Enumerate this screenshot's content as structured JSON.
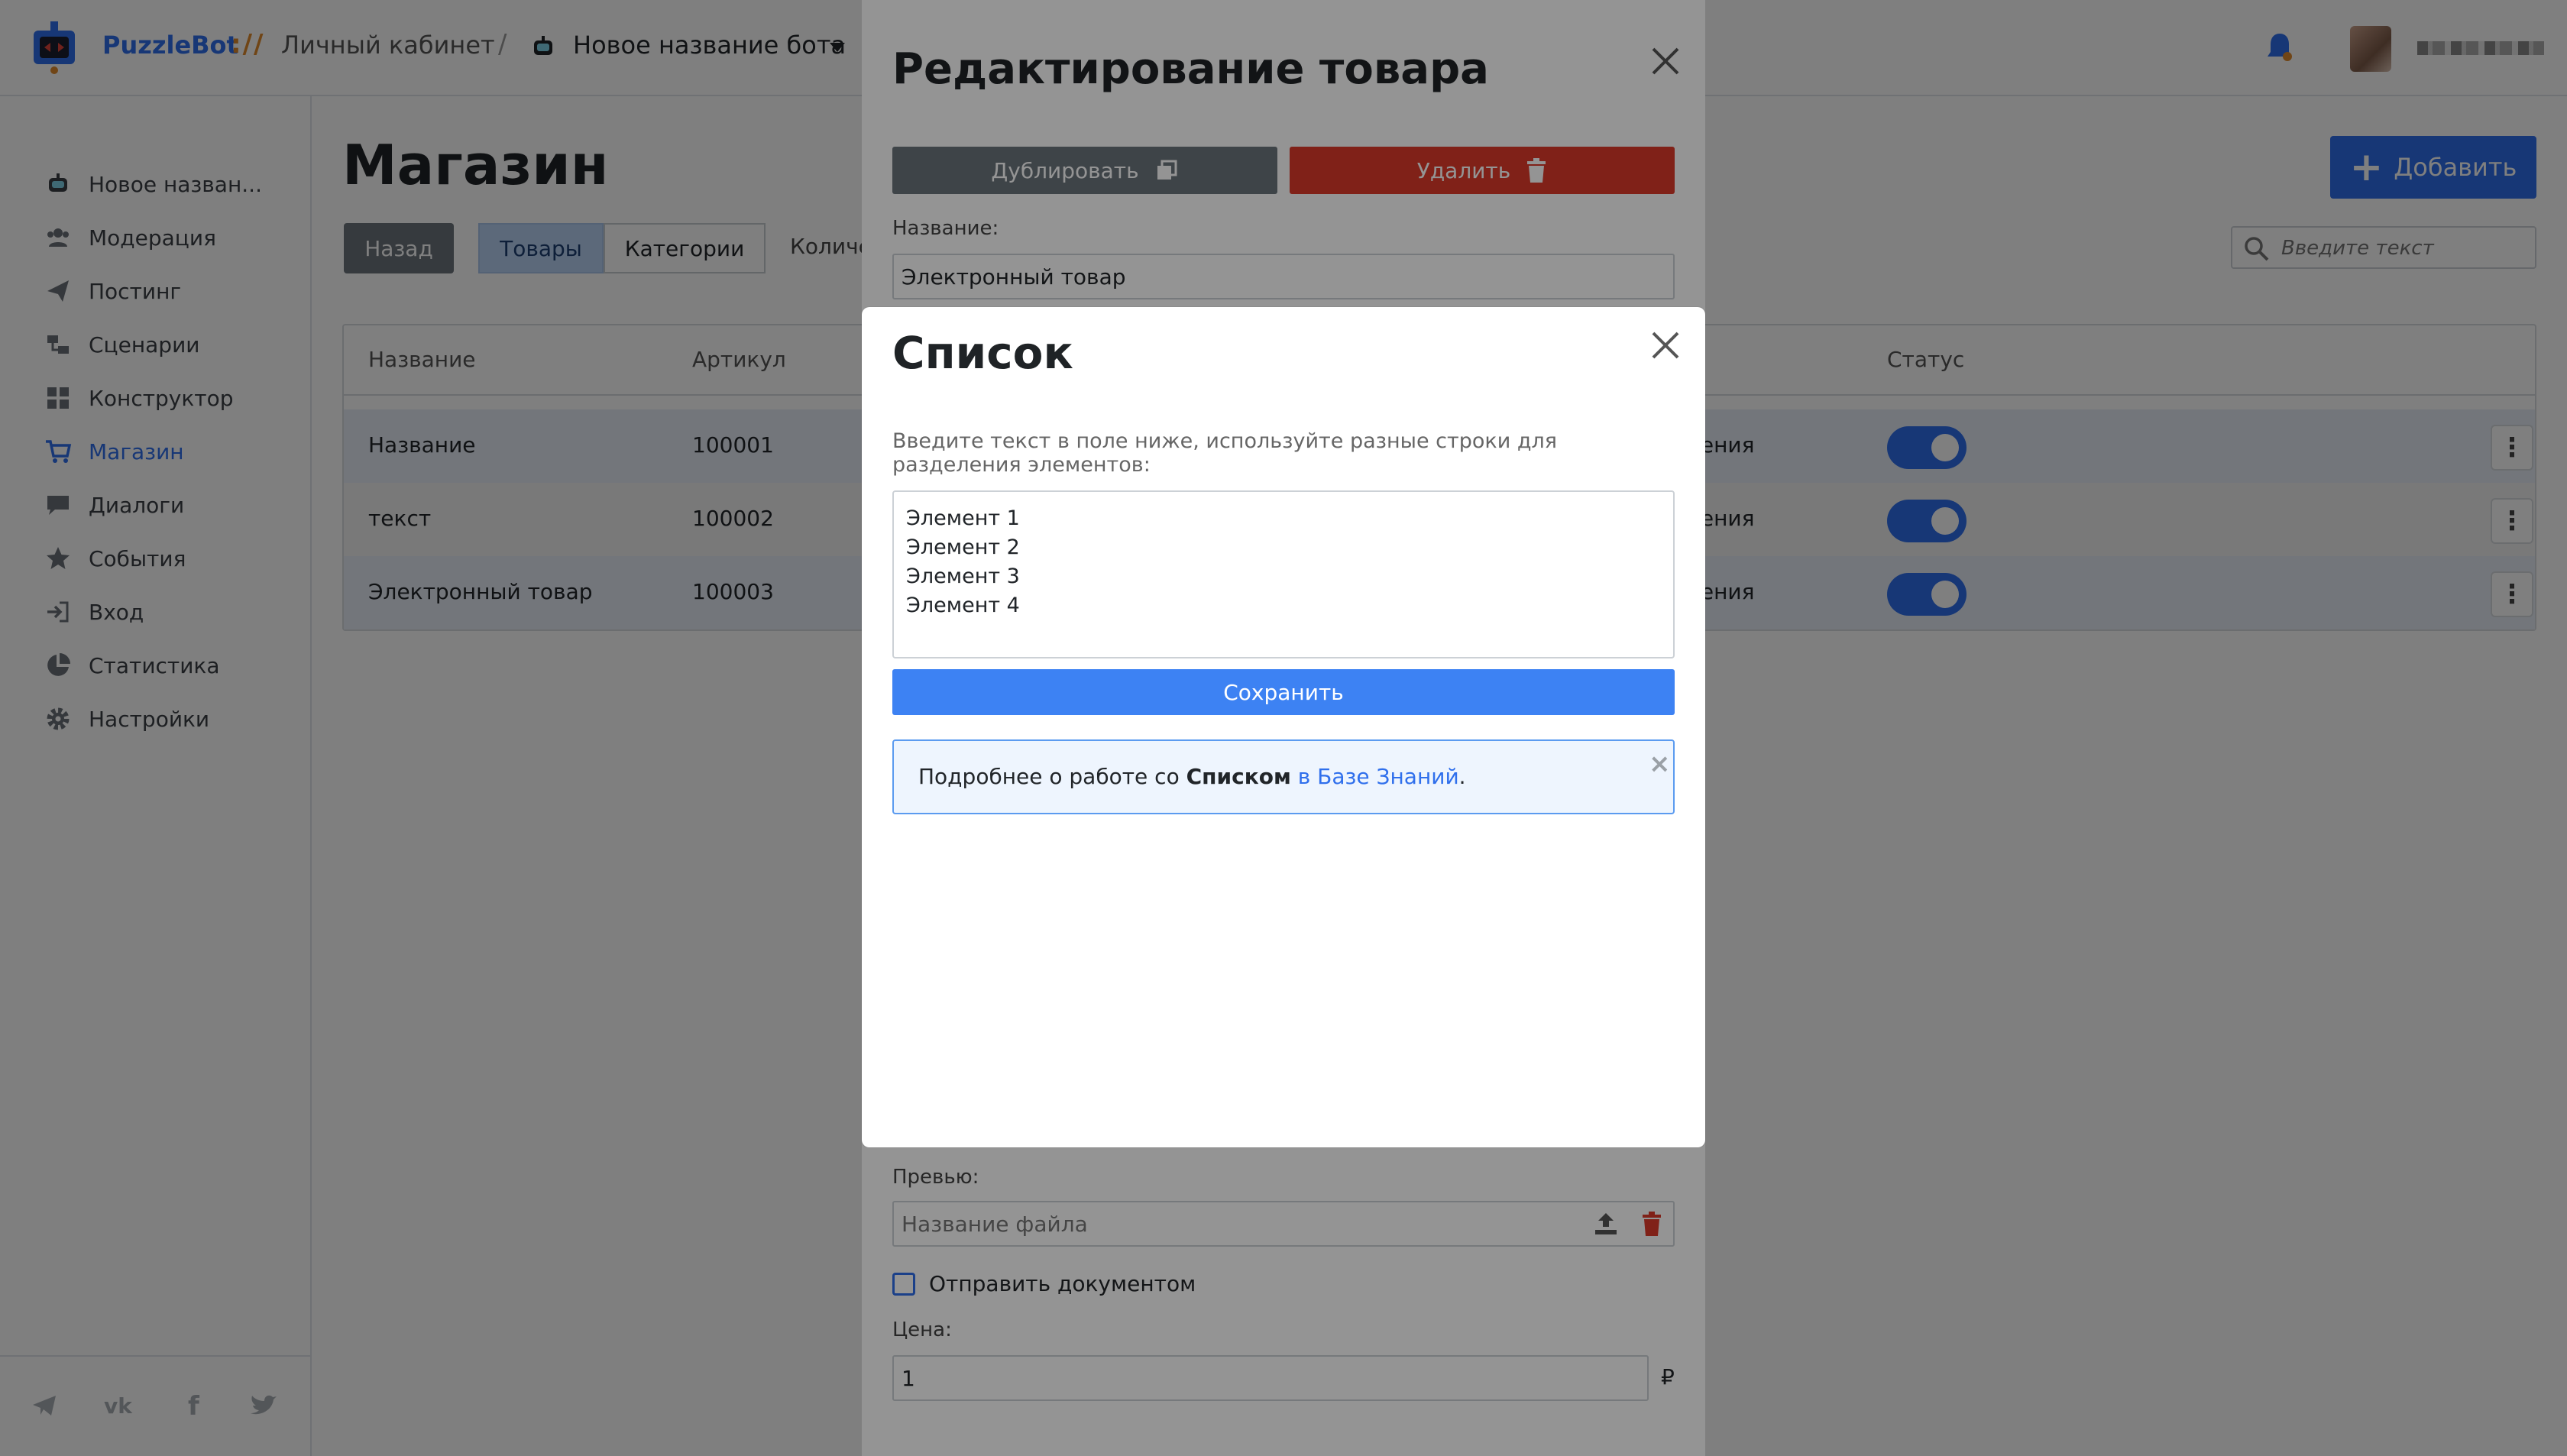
{
  "header": {
    "brand": "PuzzleBot",
    "brand_sep": "://",
    "cabinet": "Личный кабинет",
    "slash": "/",
    "bot_name": "Новое название бота"
  },
  "sidebar": {
    "items": [
      {
        "label": "Новое назван...",
        "icon": "robot-icon"
      },
      {
        "label": "Модерация",
        "icon": "users-icon"
      },
      {
        "label": "Постинг",
        "icon": "paper-plane-icon"
      },
      {
        "label": "Сценарии",
        "icon": "scenario-icon"
      },
      {
        "label": "Конструктор",
        "icon": "grid-icon"
      },
      {
        "label": "Магазин",
        "icon": "cart-icon"
      },
      {
        "label": "Диалоги",
        "icon": "chat-icon"
      },
      {
        "label": "События",
        "icon": "star-icon"
      },
      {
        "label": "Вход",
        "icon": "sign-in-icon"
      },
      {
        "label": "Статистика",
        "icon": "pie-chart-icon"
      },
      {
        "label": "Настройки",
        "icon": "gear-icon"
      }
    ],
    "active_index": 5
  },
  "shop": {
    "title": "Магазин",
    "back_label": "Назад",
    "tab_goods": "Товары",
    "tab_categories": "Категории",
    "count_label": "Количе",
    "add_label": "Добавить",
    "search_placeholder": "Введите текст",
    "columns": [
      "Название",
      "Артикул",
      "Статус"
    ],
    "rows": [
      {
        "name": "Название",
        "sku": "100001",
        "mid": "ления"
      },
      {
        "name": "текст",
        "sku": "100002",
        "mid": "ления"
      },
      {
        "name": "Электронный товар",
        "sku": "100003",
        "mid": "ления"
      }
    ]
  },
  "edit_modal": {
    "title": "Редактирование товара",
    "duplicate_label": "Дублировать",
    "delete_label": "Удалить",
    "name_label": "Название:",
    "name_value": "Электронный товар",
    "preview_label": "Превью:",
    "file_placeholder": "Название файла",
    "send_as_document": "Отправить документом",
    "price_label": "Цена:",
    "price_value": "1",
    "currency": "₽"
  },
  "list_modal": {
    "title": "Список",
    "hint": "Введите текст в поле ниже, используйте разные строки для разделения элементов:",
    "textarea_value": "Элемент 1\nЭлемент 2\nЭлемент 3\nЭлемент 4",
    "save_label": "Сохранить",
    "info_prefix": "Подробнее о работе со ",
    "info_bold": "Списком",
    "info_link": "в Базе Знаний",
    "info_suffix": ".",
    "info_close": "×"
  },
  "colors": {
    "accent": "#2f6fec",
    "danger": "#dc3a2a",
    "secondary": "#6c757d",
    "brand_sep": "#e08a2c"
  }
}
